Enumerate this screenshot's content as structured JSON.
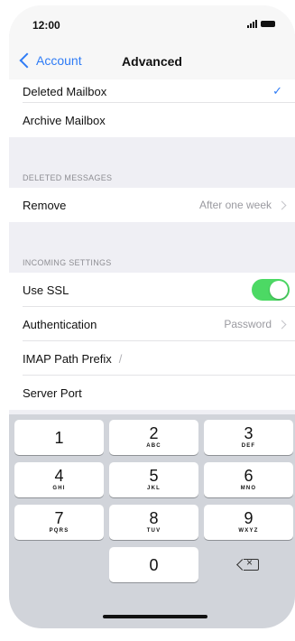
{
  "status_bar": {
    "time": "12:00",
    "signal_icon": "cellular-signal-icon",
    "battery_icon": "battery-icon"
  },
  "navbar": {
    "back_label": "Account",
    "title": "Advanced",
    "accent_color": "#2f7cf6"
  },
  "mailbox_rows": [
    {
      "label": "Deleted Mailbox",
      "checked": true
    },
    {
      "label": "Archive Mailbox",
      "checked": false
    }
  ],
  "deleted_messages": {
    "header": "DELETED MESSAGES",
    "remove_label": "Remove",
    "remove_value": "After one week"
  },
  "incoming_settings": {
    "header": "INCOMING SETTINGS",
    "use_ssl_label": "Use SSL",
    "use_ssl_on": true,
    "toggle_color": "#4cd964",
    "authentication_label": "Authentication",
    "authentication_value": "Password",
    "imap_path_prefix_label": "IMAP Path Prefix",
    "imap_path_prefix_value": "/",
    "server_port_label": "Server Port",
    "server_port_value": ""
  },
  "keyboard": {
    "keys": [
      {
        "digit": "1",
        "letters": ""
      },
      {
        "digit": "2",
        "letters": "ABC"
      },
      {
        "digit": "3",
        "letters": "DEF"
      },
      {
        "digit": "4",
        "letters": "GHI"
      },
      {
        "digit": "5",
        "letters": "JKL"
      },
      {
        "digit": "6",
        "letters": "MNO"
      },
      {
        "digit": "7",
        "letters": "PQRS"
      },
      {
        "digit": "8",
        "letters": "TUV"
      },
      {
        "digit": "9",
        "letters": "WXYZ"
      },
      {
        "digit": "0",
        "letters": ""
      }
    ],
    "delete_icon": "delete-backspace-icon"
  }
}
